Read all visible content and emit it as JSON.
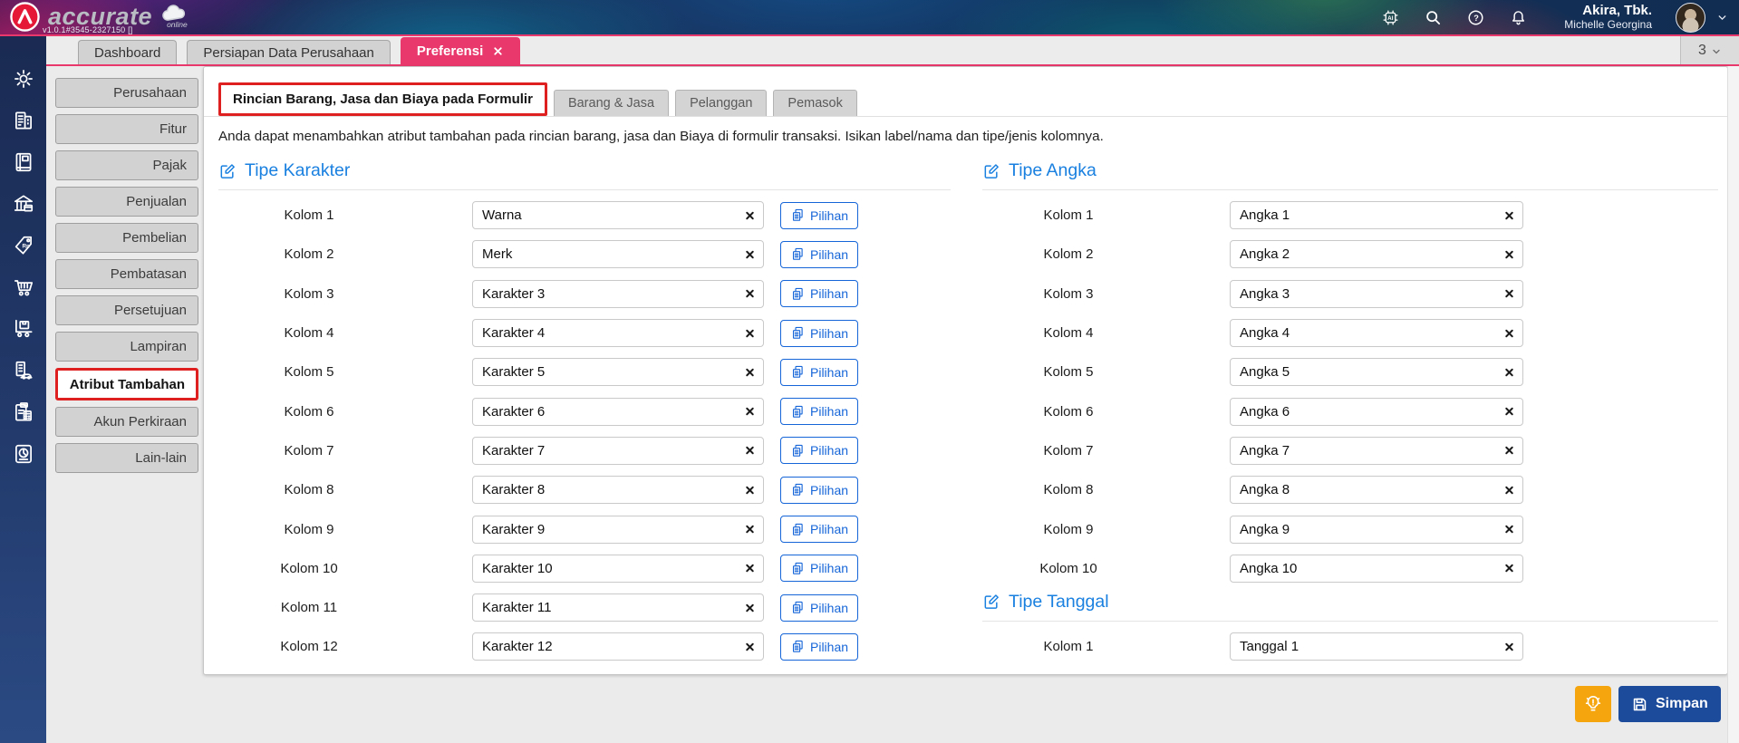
{
  "header": {
    "brand": "accurate",
    "brand_sub": "online",
    "version": "v1.0.1#3545-2327150 []",
    "company": "Akira, Tbk.",
    "user": "Michelle Georgina",
    "icons": [
      "ai-assistant-icon",
      "search-icon",
      "help-icon",
      "notifications-icon"
    ],
    "tab_overflow_count": "3"
  },
  "window_tabs": [
    {
      "label": "Dashboard",
      "active": false,
      "closable": false
    },
    {
      "label": "Persiapan Data Perusahaan",
      "active": false,
      "closable": false
    },
    {
      "label": "Preferensi",
      "active": true,
      "closable": true
    }
  ],
  "module_sidebar_icons": [
    "gear-icon",
    "company-building-icon",
    "journal-book-icon",
    "bank-icon",
    "price-tag-rp-icon",
    "shopping-cart-icon",
    "delivery-trolley-icon",
    "fixed-asset-icon",
    "tax-document-icon",
    "report-document-icon"
  ],
  "menu": {
    "items": [
      "Perusahaan",
      "Fitur",
      "Pajak",
      "Penjualan",
      "Pembelian",
      "Pembatasan",
      "Persetujuan",
      "Lampiran",
      "Atribut Tambahan",
      "Akun Perkiraan",
      "Lain-lain"
    ],
    "active": "Atribut Tambahan"
  },
  "content": {
    "tabs": [
      {
        "label": "Rincian Barang, Jasa dan Biaya pada Formulir",
        "active": true,
        "highlighted": true
      },
      {
        "label": "Barang & Jasa",
        "active": false
      },
      {
        "label": "Pelanggan",
        "active": false
      },
      {
        "label": "Pemasok",
        "active": false
      }
    ],
    "description": "Anda dapat menambahkan atribut tambahan pada rincian barang, jasa dan Biaya di formulir transaksi. Isikan label/nama dan tipe/jenis kolomnya.",
    "sections": {
      "karakter": {
        "title": "Tipe Karakter",
        "pilihan_label": "Pilihan",
        "rows": [
          {
            "label": "Kolom 1",
            "value": "Warna"
          },
          {
            "label": "Kolom 2",
            "value": "Merk"
          },
          {
            "label": "Kolom 3",
            "value": "Karakter 3"
          },
          {
            "label": "Kolom 4",
            "value": "Karakter 4"
          },
          {
            "label": "Kolom 5",
            "value": "Karakter 5"
          },
          {
            "label": "Kolom 6",
            "value": "Karakter 6"
          },
          {
            "label": "Kolom 7",
            "value": "Karakter 7"
          },
          {
            "label": "Kolom 8",
            "value": "Karakter 8"
          },
          {
            "label": "Kolom 9",
            "value": "Karakter 9"
          },
          {
            "label": "Kolom 10",
            "value": "Karakter 10"
          },
          {
            "label": "Kolom 11",
            "value": "Karakter 11"
          },
          {
            "label": "Kolom 12",
            "value": "Karakter 12"
          }
        ]
      },
      "angka": {
        "title": "Tipe Angka",
        "rows": [
          {
            "label": "Kolom 1",
            "value": "Angka 1"
          },
          {
            "label": "Kolom 2",
            "value": "Angka 2"
          },
          {
            "label": "Kolom 3",
            "value": "Angka 3"
          },
          {
            "label": "Kolom 4",
            "value": "Angka 4"
          },
          {
            "label": "Kolom 5",
            "value": "Angka 5"
          },
          {
            "label": "Kolom 6",
            "value": "Angka 6"
          },
          {
            "label": "Kolom 7",
            "value": "Angka 7"
          },
          {
            "label": "Kolom 8",
            "value": "Angka 8"
          },
          {
            "label": "Kolom 9",
            "value": "Angka 9"
          },
          {
            "label": "Kolom 10",
            "value": "Angka 10"
          }
        ]
      },
      "tanggal": {
        "title": "Tipe Tanggal",
        "rows": [
          {
            "label": "Kolom 1",
            "value": "Tanggal 1"
          }
        ]
      }
    }
  },
  "footer": {
    "save_label": "Simpan",
    "hint_icon": "lightbulb-icon"
  },
  "colors": {
    "accent_pink": "#e9386b",
    "highlight_red": "#df2020",
    "heading_blue": "#1a80e0",
    "button_blue": "#1565d8",
    "save_navy": "#1d4b9b",
    "hint_orange": "#f5a60f",
    "sidebar_navy": "#1a2a52"
  }
}
